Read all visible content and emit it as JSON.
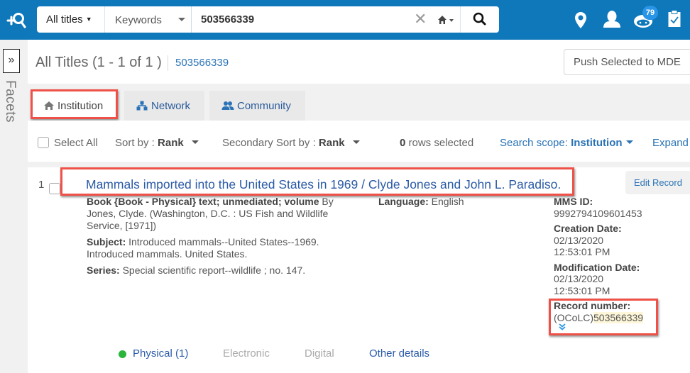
{
  "search": {
    "type_label": "All titles",
    "field_label": "Keywords",
    "query_value": "503566339"
  },
  "topbar": {
    "icons": [
      "search-plus-icon",
      "location-pin-icon",
      "user-icon",
      "chat-bot-icon",
      "clipboard-check-icon"
    ],
    "notification_count": "79"
  },
  "facets": {
    "toggle_label": "»",
    "label": "Facets"
  },
  "header": {
    "title": "All Titles (1 - 1 of 1 )",
    "query": "503566339",
    "push_button": "Push Selected to MDE"
  },
  "tabs": [
    {
      "label": "Institution",
      "icon": "home-icon",
      "active": true
    },
    {
      "label": "Network",
      "icon": "network-icon",
      "active": false
    },
    {
      "label": "Community",
      "icon": "community-icon",
      "active": false
    }
  ],
  "toolbar": {
    "select_all": "Select All",
    "sort_label": "Sort by :",
    "sort_value": "Rank",
    "secondary_sort_label": "Secondary Sort by :",
    "secondary_sort_value": "Rank",
    "rows_selected_count": "0",
    "rows_selected_label": "rows selected",
    "scope_label": "Search scope:",
    "scope_value": "Institution",
    "expand_label": "Expand"
  },
  "result": {
    "index": "1",
    "title": "Mammals imported into the United States in 1969 / Clyde Jones and John L. Paradiso.",
    "edit_button": "Edit Record",
    "format_bold": "Book {Book - Physical} text; unmediated; volume",
    "format_rest": " By Jones, Clyde. (Washington, D.C. : US Fish and Wildlife Service, [1971])",
    "subject_label": "Subject:",
    "subject_value": " Introduced mammals--United States--1969. Introduced mammals. United States.",
    "series_label": "Series:",
    "series_value": " Special scientific report--wildlife ; no. 147.",
    "language_label": "Language:",
    "language_value": " English",
    "mms_label": "MMS ID:",
    "mms_value": "9992794109601453",
    "creation_label": "Creation Date:",
    "creation_date": "02/13/2020",
    "creation_time": "12:53:01 PM",
    "modification_label": "Modification Date:",
    "modification_date": "02/13/2020",
    "modification_time": "12:53:01 PM",
    "record_label": "Record number:",
    "record_prefix": "(OCoLC)",
    "record_value": "503566339",
    "footer": {
      "physical": "Physical (1)",
      "electronic": "Electronic",
      "digital": "Digital",
      "other": "Other details"
    }
  },
  "colors": {
    "topbar": "#0e78bb",
    "link": "#2a73b6",
    "title": "#2a5aa6",
    "highlight_box": "#ef5148",
    "available_dot": "#2bb53a",
    "badge": "#2a95e6"
  }
}
